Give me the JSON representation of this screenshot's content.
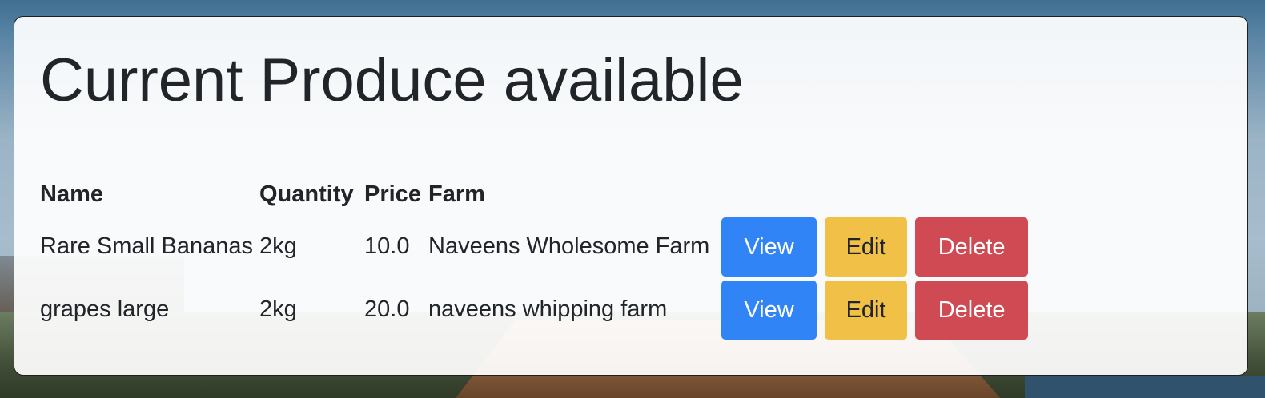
{
  "page": {
    "title": "Current Produce available"
  },
  "table": {
    "headers": {
      "name": "Name",
      "quantity": "Quantity",
      "price": "Price",
      "farm": "Farm"
    },
    "rows": [
      {
        "name": "Rare Small Bananas",
        "quantity": "2kg",
        "price": "10.0",
        "farm": "Naveens Wholesome Farm",
        "view_label": "View",
        "edit_label": "Edit",
        "delete_label": "Delete"
      },
      {
        "name": "grapes large",
        "quantity": "2kg",
        "price": "20.0",
        "farm": "naveens whipping farm",
        "view_label": "View",
        "edit_label": "Edit",
        "delete_label": "Delete"
      }
    ]
  },
  "colors": {
    "view": "#3184f5",
    "edit": "#f1c047",
    "delete": "#cf4a52",
    "text": "#212529"
  }
}
